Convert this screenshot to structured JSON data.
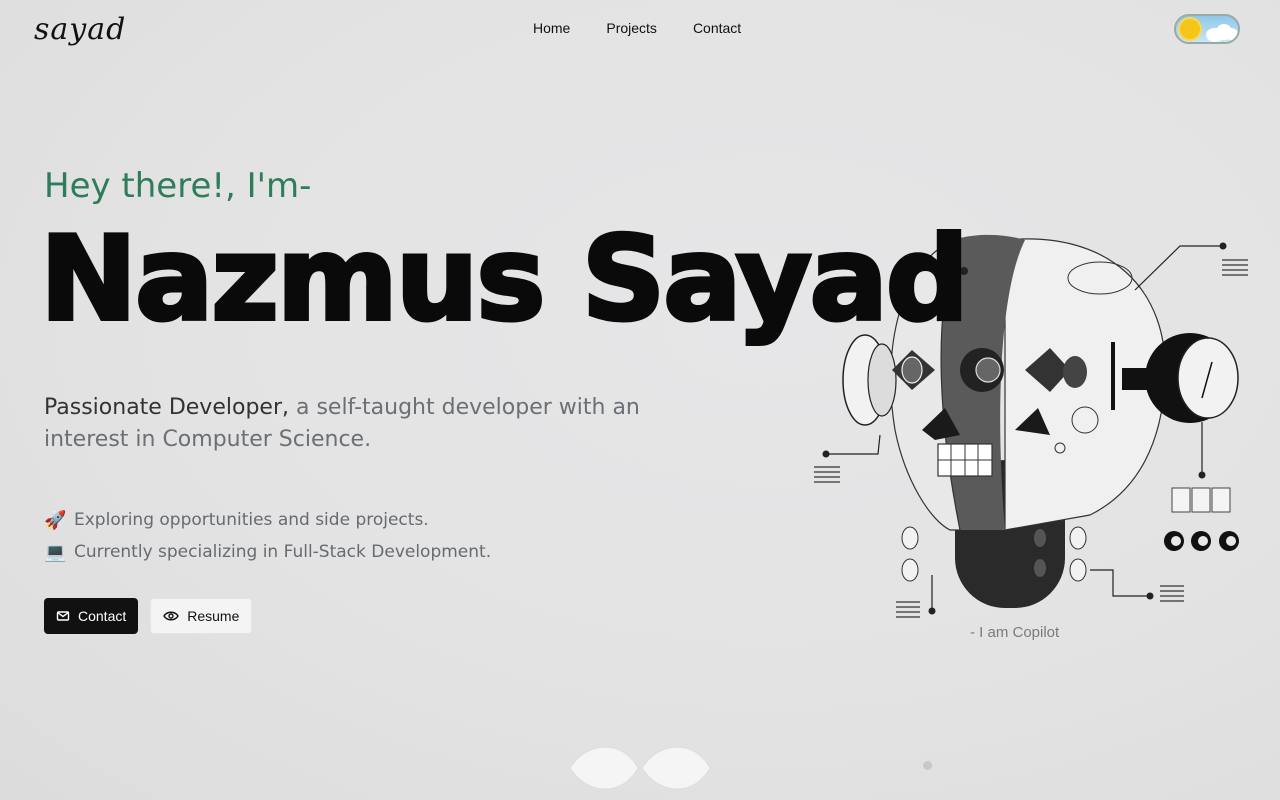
{
  "brand": {
    "logo": "sayad"
  },
  "nav": {
    "items": [
      "Home",
      "Projects",
      "Contact"
    ]
  },
  "theme_toggle": {
    "icon": "sun-cloud-icon",
    "colors": {
      "sky": "#8fc9e8",
      "sun": "#f5c518"
    }
  },
  "hero": {
    "greeting": "Hey there!, I'm-",
    "name": "Nazmus Sayad",
    "description_strong": "Passionate Developer,",
    "description_rest": " a self-taught developer with an interest in Computer Science.",
    "bullets": [
      {
        "icon": "rocket-icon",
        "emoji": "🚀",
        "text": "Exploring opportunities and side projects."
      },
      {
        "icon": "laptop-icon",
        "emoji": "💻",
        "text": "Currently specializing in Full-Stack Development."
      }
    ],
    "buttons": {
      "contact": {
        "label": "Contact",
        "icon": "mail-icon"
      },
      "resume": {
        "label": "Resume",
        "icon": "eye-icon"
      }
    }
  },
  "illustration": {
    "caption": "- I am Copilot"
  },
  "colors": {
    "accent": "#2e7d5a",
    "text": "#0a0a0a",
    "muted": "#6b6f76"
  }
}
